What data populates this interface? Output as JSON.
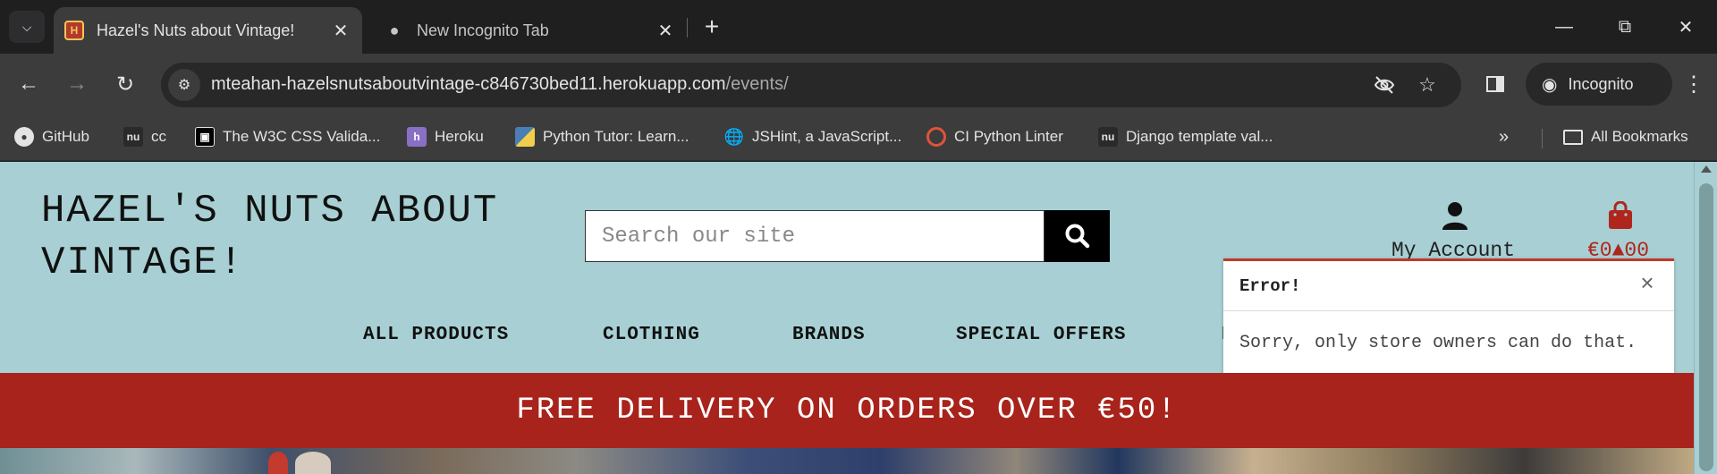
{
  "browser": {
    "tabs": [
      {
        "title": "Hazel's Nuts about Vintage!",
        "active": true
      },
      {
        "title": "New Incognito Tab",
        "active": false
      }
    ],
    "address": {
      "host": "mteahan-hazelsnutsaboutvintage-c846730bed11.herokuapp.com",
      "path": "/events/"
    },
    "incognito_label": "Incognito",
    "bookmarks": [
      {
        "label": "GitHub",
        "icon": "github-icon"
      },
      {
        "label": "cc",
        "icon": "nu-icon"
      },
      {
        "label": "The W3C CSS Valida...",
        "icon": "w3c-icon"
      },
      {
        "label": "Heroku",
        "icon": "heroku-icon"
      },
      {
        "label": "Python Tutor: Learn...",
        "icon": "python-icon"
      },
      {
        "label": "JSHint, a JavaScript...",
        "icon": "globe-icon"
      },
      {
        "label": "CI Python Linter",
        "icon": "ring-icon"
      },
      {
        "label": "Django template val...",
        "icon": "nu-icon"
      }
    ],
    "all_bookmarks_label": "All Bookmarks"
  },
  "site": {
    "logo_line1": "HAZEL'S NUTS ABOUT",
    "logo_line2": "VINTAGE!",
    "search_placeholder": "Search our site",
    "account_label": "My Account",
    "bag_total": "€0▲00",
    "nav": [
      "ALL PRODUCTS",
      "CLOTHING",
      "BRANDS",
      "SPECIAL OFFERS",
      "E"
    ],
    "delivery_banner": "FREE DELIVERY ON ORDERS OVER €50!",
    "toast": {
      "title": "Error!",
      "message": "Sorry, only store owners can do that."
    }
  },
  "colors": {
    "page_bg": "#a8d0d4",
    "banner_red": "#a8231b",
    "bag_red": "#b0261c",
    "toast_border": "#c0392b"
  }
}
